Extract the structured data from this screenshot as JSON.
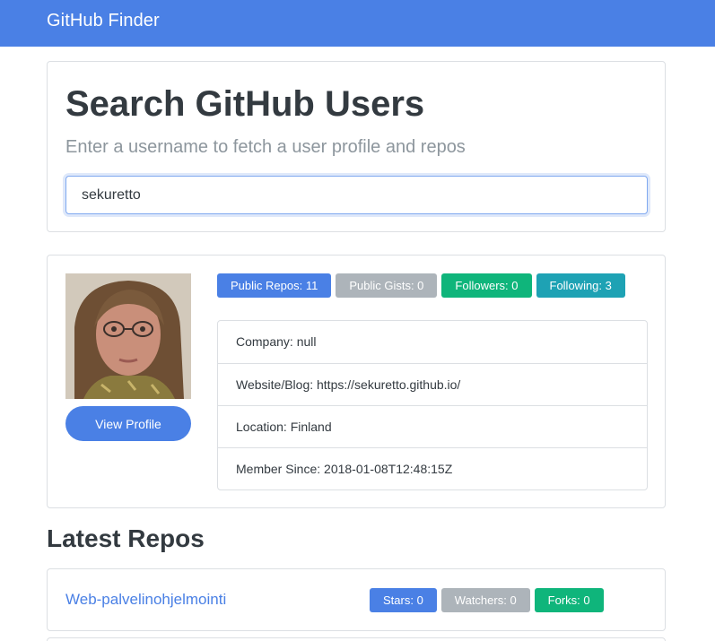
{
  "navbar": {
    "brand": "GitHub Finder"
  },
  "search": {
    "title": "Search GitHub Users",
    "subtitle": "Enter a username to fetch a user profile and repos",
    "value": "sekuretto"
  },
  "profile": {
    "view_profile_label": "View Profile",
    "badges": [
      {
        "label": "Public Repos: 11",
        "color": "#4a80e5"
      },
      {
        "label": "Public Gists: 0",
        "color": "#adb4ba"
      },
      {
        "label": "Followers: 0",
        "color": "#0fb57b"
      },
      {
        "label": "Following: 3",
        "color": "#1ea2b4"
      }
    ],
    "details": [
      "Company: null",
      "Website/Blog: https://sekuretto.github.io/",
      "Location: Finland",
      "Member Since: 2018-01-08T12:48:15Z"
    ]
  },
  "repos": {
    "heading": "Latest Repos",
    "items": [
      {
        "name": "Web-palvelinohjelmointi",
        "stars": "Stars: 0",
        "watchers": "Watchers: 0",
        "forks": "Forks: 0"
      }
    ]
  },
  "colors": {
    "primary": "#4a80e5",
    "secondary": "#adb4ba",
    "success": "#0fb57b",
    "info": "#1ea2b4"
  }
}
